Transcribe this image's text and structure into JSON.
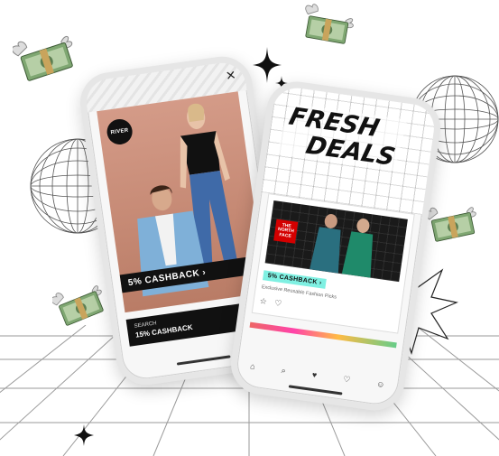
{
  "left_phone": {
    "close_icon": "×",
    "brand_logo": "RIVER",
    "cashback_banner": "5% CASHBACK ›",
    "footer_line1": "SEARCH",
    "footer_line2": "15% CASHBACK"
  },
  "right_phone": {
    "title_line1": "FRESH",
    "title_line2": "DEALS",
    "brand_logo": "THE NORTH FACE",
    "cashback_badge": "5% CASHBACK ›",
    "description": "Exclusive Reusable Fashion Picks",
    "rating_icons": "☆ ♡",
    "nav_icons": [
      "⌂",
      "⌕",
      "♥",
      "♡",
      "☺"
    ]
  },
  "colors": {
    "badge": "#7ff0e2",
    "hero_background": "#c68a75",
    "card_background": "#1a1a1a"
  },
  "icons": [
    "money-wings-icon",
    "sparkle-icon",
    "wire-sphere-icon",
    "starburst-icon"
  ]
}
